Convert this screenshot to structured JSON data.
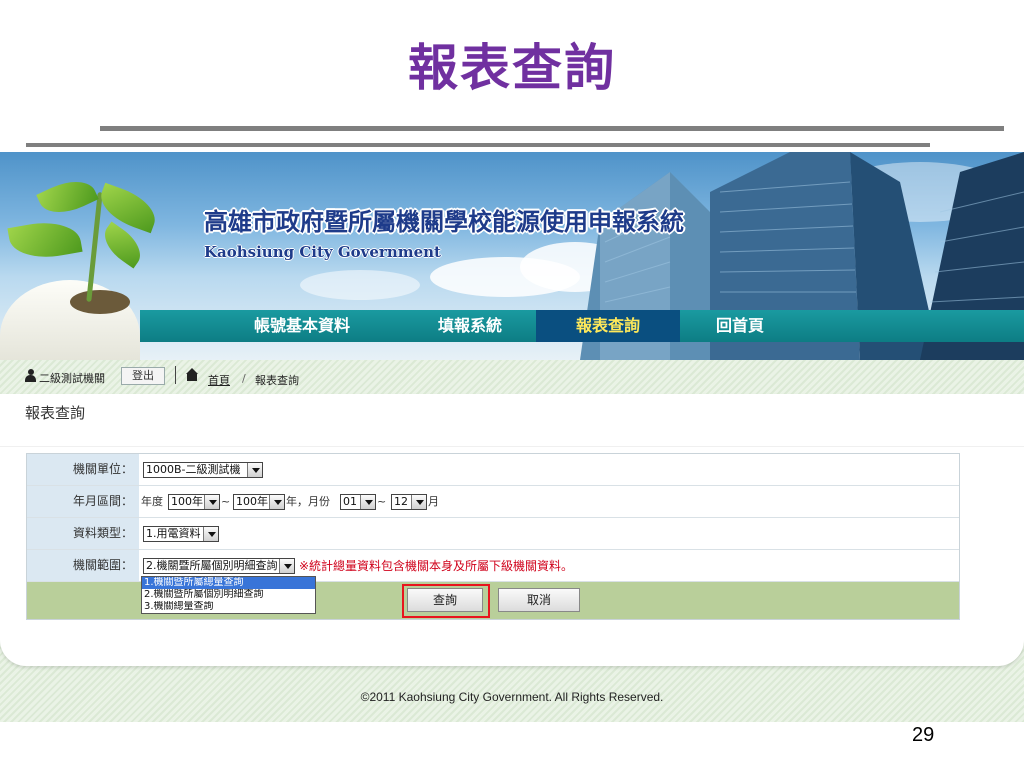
{
  "slide": {
    "title": "報表查詢",
    "page_number": "29"
  },
  "banner": {
    "title_cn": "高雄市政府暨所屬機關學校能源使用申報系統",
    "title_en": "Kaohsiung City Government"
  },
  "nav": {
    "items": [
      {
        "label": "帳號基本資料",
        "active": false
      },
      {
        "label": "填報系統",
        "active": false
      },
      {
        "label": "報表查詢",
        "active": true
      },
      {
        "label": "回首頁",
        "active": false
      }
    ]
  },
  "toolbar": {
    "user": "二級測試機關",
    "logout": "登出",
    "breadcrumb": {
      "home": "首頁",
      "separator": "/",
      "current": "報表查詢"
    }
  },
  "panel": {
    "title": "報表查詢"
  },
  "form": {
    "agency": {
      "label": "機關單位：",
      "value": "1000B-二級測試機"
    },
    "period": {
      "label": "年月區間：",
      "year_prefix": "年度",
      "year_from": "100年",
      "tilde1": "~",
      "year_to": "100年",
      "year_suffix": "年，月份",
      "month_from": "01",
      "tilde2": "~",
      "month_to": "12",
      "month_suffix": "月"
    },
    "data_type": {
      "label": "資料類型：",
      "value": "1.用電資料"
    },
    "scope": {
      "label": "機關範圍：",
      "value": "2.機關暨所屬個別明細查詢",
      "note": "※統計總量資料包含機關本身及所屬下級機關資料。",
      "options": [
        "1.機關暨所屬總量查詢",
        "2.機關暨所屬個別明細查詢",
        "3.機關總量查詢"
      ],
      "highlighted_option": "1.機關暨所屬總量查詢"
    },
    "query_button": "查詢",
    "cancel_button": "取消"
  },
  "footer": "©2011 Kaohsiung City Government. All Rights Reserved.",
  "colors": {
    "title": "#7030a0",
    "nav": "#0d7d84",
    "nav_active": "#0a4f80",
    "highlight_box": "#e8141e",
    "note": "#d0021b"
  }
}
